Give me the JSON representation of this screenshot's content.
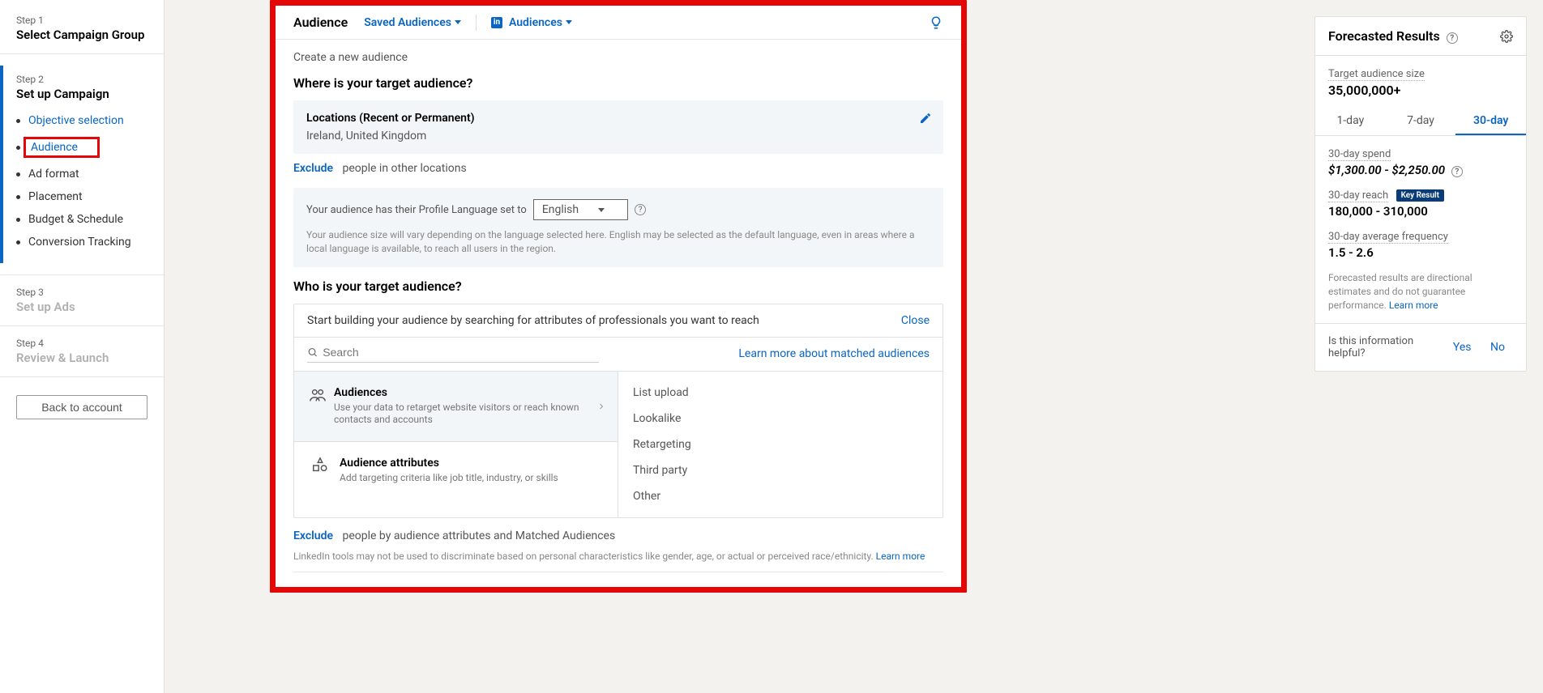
{
  "sidebar": {
    "step1": {
      "label": "Step 1",
      "title": "Select Campaign Group"
    },
    "step2": {
      "label": "Step 2",
      "title": "Set up Campaign",
      "items": [
        {
          "label": "Objective selection"
        },
        {
          "label": "Audience"
        },
        {
          "label": "Ad format"
        },
        {
          "label": "Placement"
        },
        {
          "label": "Budget & Schedule"
        },
        {
          "label": "Conversion Tracking"
        }
      ]
    },
    "step3": {
      "label": "Step 3",
      "title": "Set up Ads"
    },
    "step4": {
      "label": "Step 4",
      "title": "Review & Launch"
    },
    "back": "Back to account"
  },
  "audience": {
    "header": {
      "title": "Audience",
      "saved": "Saved Audiences",
      "linkedin": "Audiences"
    },
    "create_label": "Create a new audience",
    "where": {
      "title": "Where is your target audience?",
      "locations_label": "Locations (Recent or Permanent)",
      "locations_value": "Ireland, United Kingdom",
      "exclude": "Exclude",
      "exclude_text": "people in other locations"
    },
    "language": {
      "pre": "Your audience has their Profile Language set to",
      "value": "English",
      "hint": "Your audience size will vary depending on the language selected here. English may be selected as the default language, even in areas where a local language is available, to reach all users in the region."
    },
    "who": {
      "title": "Who is your target audience?",
      "prompt": "Start building your audience by searching for attributes of professionals you want to reach",
      "close": "Close",
      "search_placeholder": "Search",
      "learn_matched": "Learn more about matched audiences",
      "tiles": {
        "audiences": {
          "label": "Audiences",
          "desc": "Use your data to retarget website visitors or reach known contacts and accounts"
        },
        "attrs": {
          "label": "Audience attributes",
          "desc": "Add targeting criteria like job title, industry, or skills"
        }
      },
      "right_options": [
        "List upload",
        "Lookalike",
        "Retargeting",
        "Third party",
        "Other"
      ],
      "exclude": "Exclude",
      "exclude_text": "people by audience attributes and Matched Audiences"
    },
    "footer_note": "LinkedIn tools may not be used to discriminate based on personal characteristics like gender, age, or actual or perceived race/ethnicity. ",
    "footer_learn": "Learn more"
  },
  "forecast": {
    "title": "Forecasted Results",
    "target_label": "Target audience size",
    "target_value": "35,000,000+",
    "tabs": [
      "1-day",
      "7-day",
      "30-day"
    ],
    "spend_label": "30-day spend",
    "spend_value": "$1,300.00 - $2,250.00",
    "reach_label": "30-day reach",
    "key_badge": "Key Result",
    "reach_value": "180,000 - 310,000",
    "freq_label": "30-day average frequency",
    "freq_value": "1.5 - 2.6",
    "disclaimer": "Forecasted results are directional estimates and do not guarantee performance. ",
    "learn": "Learn more",
    "helpful_q": "Is this information helpful?",
    "yes": "Yes",
    "no": "No"
  }
}
